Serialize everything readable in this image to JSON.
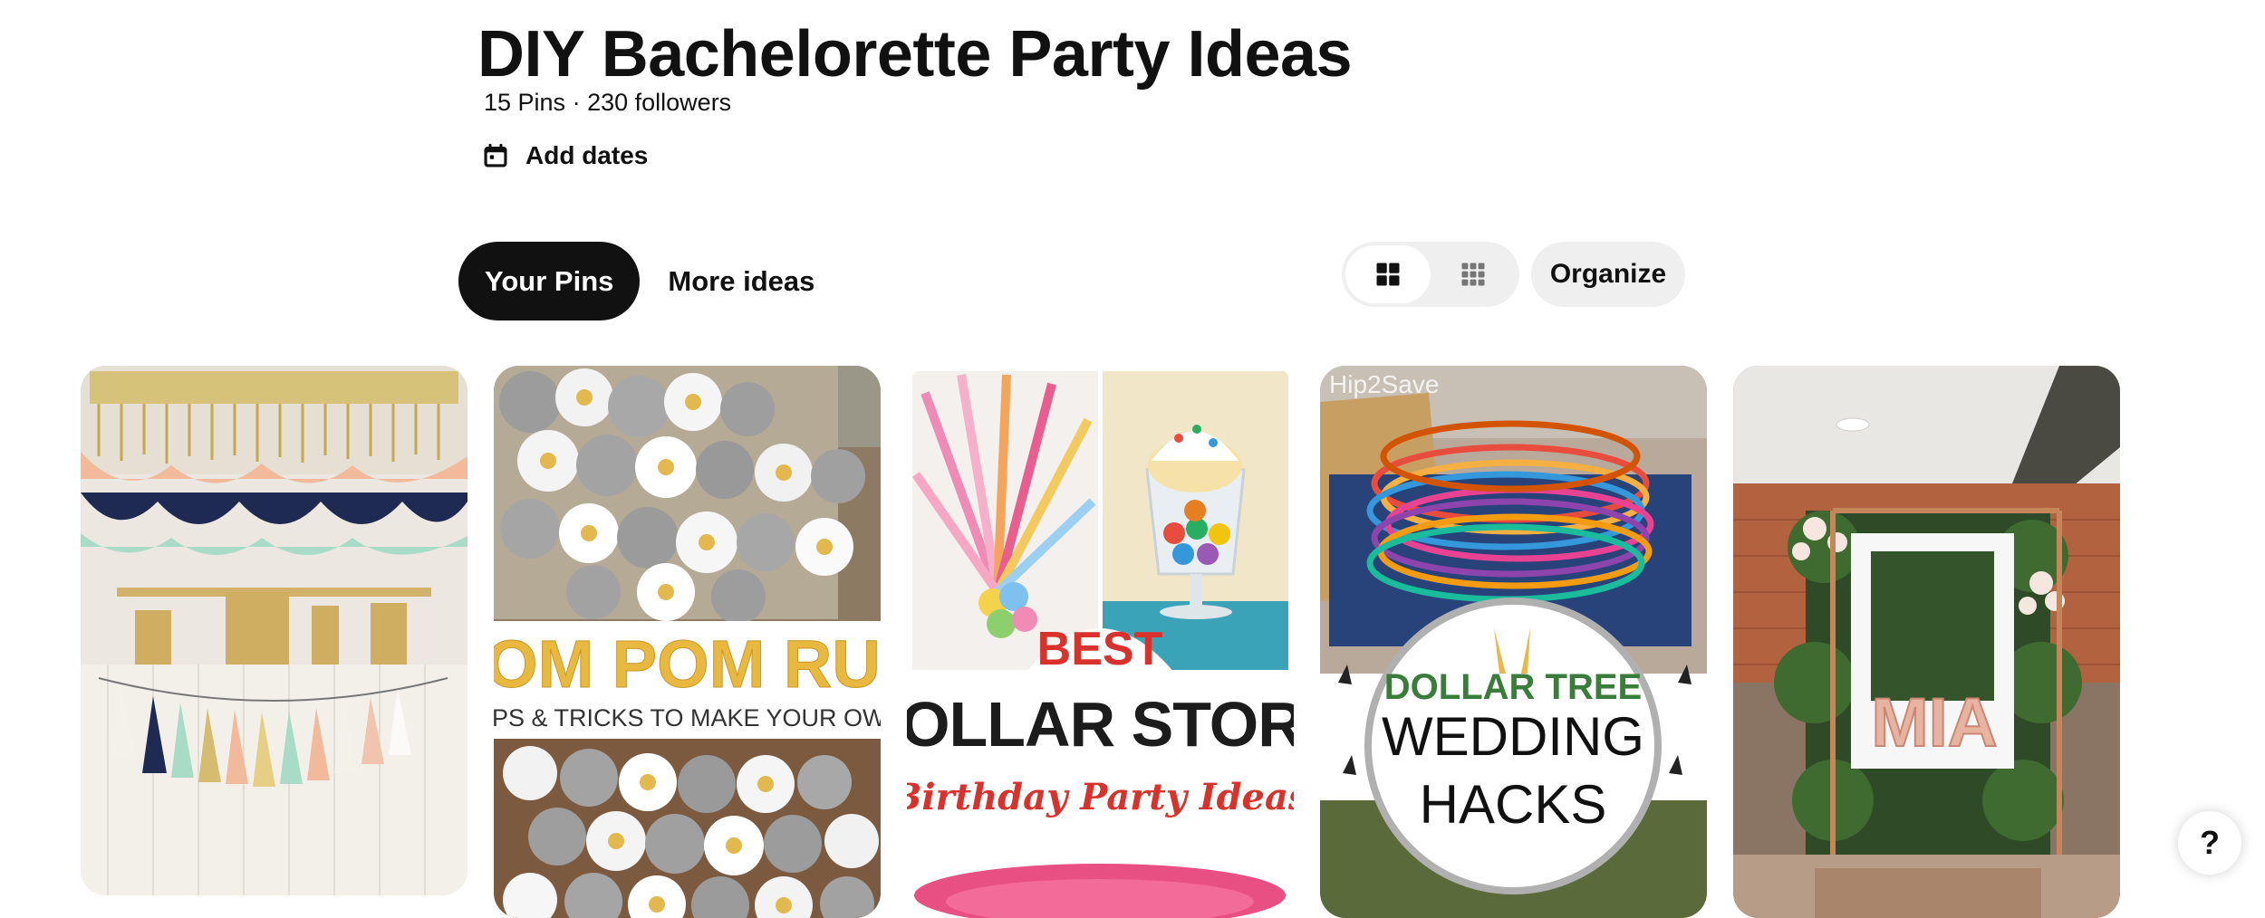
{
  "board": {
    "title": "DIY Bachelorette Party Ideas",
    "pins_count": "15 Pins",
    "separator": "·",
    "followers": "230 followers",
    "add_dates_label": "Add dates",
    "add_dates_icon": "calendar-icon"
  },
  "tabs": [
    {
      "label": "Your Pins",
      "active": true
    },
    {
      "label": "More ideas",
      "active": false
    }
  ],
  "toolbar": {
    "view_options": [
      {
        "name": "default-grid",
        "icon": "grid-large-icon",
        "selected": true
      },
      {
        "name": "compact-grid",
        "icon": "grid-compact-icon",
        "selected": false
      }
    ],
    "organize_label": "Organize"
  },
  "pins": [
    {
      "image": "gold and pastel party garland with tassels"
    },
    {
      "image": "pom pom rug",
      "text_line1": "POM POM RUG",
      "text_line2": "TIPS & TRICKS TO MAKE YOUR OWN"
    },
    {
      "image": "dollar store birthday party ideas collage",
      "text_line1": "BEST",
      "text_line2": "DOLLAR STORE",
      "text_line3": "Birthday Party Ideas"
    },
    {
      "image": "hula hoops in a box",
      "watermark": "Hip2Save",
      "text_line1": "DOLLAR TREE",
      "text_line2": "WEDDING",
      "text_line3": "HACKS"
    },
    {
      "image": "photo frame backdrop with greenery and balloons",
      "balloon_text": "MIA"
    }
  ],
  "help": {
    "label": "?"
  },
  "colors": {
    "tab_active_bg": "#111111",
    "pill_bg": "#efefef",
    "text": "#111111"
  }
}
